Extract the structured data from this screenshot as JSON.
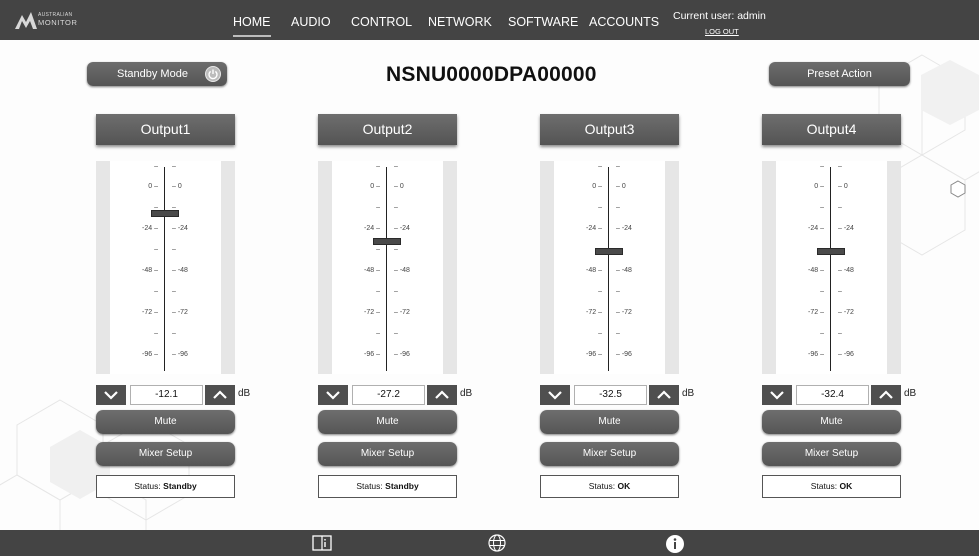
{
  "app": {
    "logo_line1": "AUSTRALIAN",
    "logo_line2": "MONITOR"
  },
  "nav": {
    "items": [
      {
        "label": "HOME",
        "active": true
      },
      {
        "label": "AUDIO"
      },
      {
        "label": "CONTROL"
      },
      {
        "label": "NETWORK"
      },
      {
        "label": "SOFTWARE"
      },
      {
        "label": "ACCOUNTS"
      }
    ],
    "user_label": "Current user: admin",
    "logout_label": "LOG OUT"
  },
  "header": {
    "standby_label": "Standby Mode",
    "device_name": "NSNU0000DPA00000",
    "preset_label": "Preset Action"
  },
  "scale": {
    "left_labels": [
      "–",
      "0 –",
      "–",
      "-24 –",
      "–",
      "-48 –",
      "–",
      "-72 –",
      "–",
      "-96 –"
    ],
    "right_labels": [
      "–",
      "– 0",
      "–",
      "– -24",
      "–",
      "– -48",
      "–",
      "– -72",
      "–",
      "– -96"
    ]
  },
  "outputs": [
    {
      "name": "Output1",
      "value": "-12.1",
      "level_db": -12.1,
      "unit": "dB",
      "mute_label": "Mute",
      "mixer_label": "Mixer Setup",
      "status_prefix": "Status:",
      "status_value": "Standby"
    },
    {
      "name": "Output2",
      "value": "-27.2",
      "level_db": -27.2,
      "unit": "dB",
      "mute_label": "Mute",
      "mixer_label": "Mixer Setup",
      "status_prefix": "Status:",
      "status_value": "Standby"
    },
    {
      "name": "Output3",
      "value": "-32.5",
      "level_db": -32.5,
      "unit": "dB",
      "mute_label": "Mute",
      "mixer_label": "Mixer Setup",
      "status_prefix": "Status:",
      "status_value": "OK"
    },
    {
      "name": "Output4",
      "value": "-32.4",
      "level_db": -32.4,
      "unit": "dB",
      "mute_label": "Mute",
      "mixer_label": "Mixer Setup",
      "status_prefix": "Status:",
      "status_value": "OK"
    }
  ],
  "footer": {
    "icons": [
      "manual-book-icon",
      "network-globe-icon",
      "info-icon"
    ]
  },
  "colors": {
    "bar": "#444444",
    "button": "#606060",
    "background": "#fdfdfd"
  }
}
